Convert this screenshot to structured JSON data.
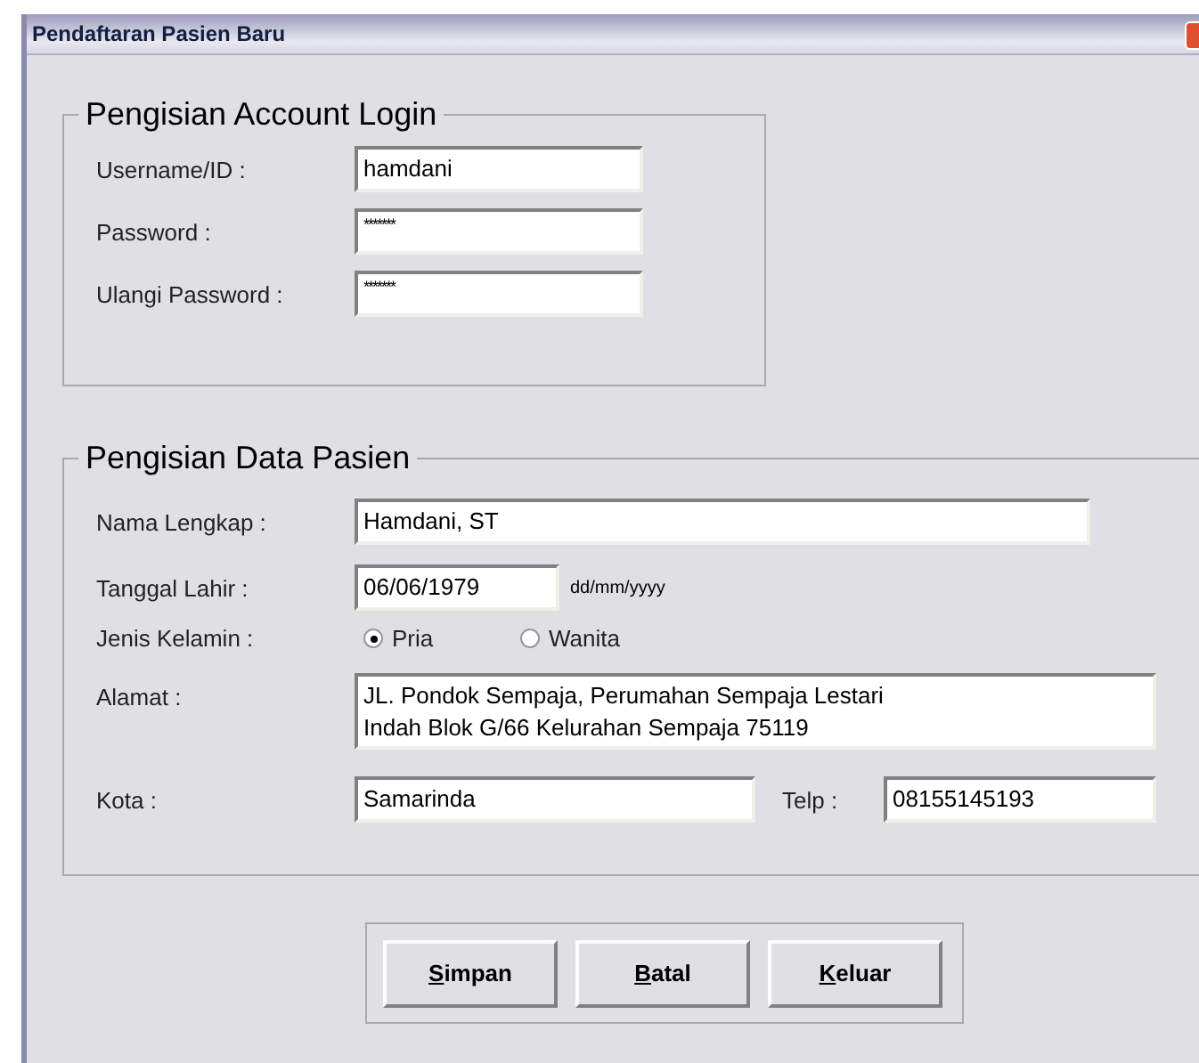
{
  "window": {
    "title": "Pendaftaran Pasien Baru"
  },
  "account_group": {
    "legend": "Pengisian Account Login",
    "fields": [
      {
        "label": "Username/ID :",
        "value": "hamdani",
        "kind": "text"
      },
      {
        "label": "Password :",
        "value": "*******",
        "kind": "password"
      },
      {
        "label": "Ulangi Password :",
        "value": "*******",
        "kind": "password"
      }
    ]
  },
  "patient_group": {
    "legend": "Pengisian Data Pasien",
    "nama": {
      "label": "Nama Lengkap :",
      "value": "Hamdani, ST"
    },
    "tanggal": {
      "label": "Tanggal Lahir :",
      "value": "06/06/1979",
      "hint": "dd/mm/yyyy"
    },
    "gender": {
      "label": "Jenis Kelamin :",
      "options": [
        {
          "label": "Pria",
          "selected": true
        },
        {
          "label": "Wanita",
          "selected": false
        }
      ]
    },
    "alamat": {
      "label": "Alamat :",
      "lines": [
        "JL. Pondok Sempaja, Perumahan Sempaja Lestari",
        "Indah Blok G/66 Kelurahan Sempaja 75119"
      ]
    },
    "kota": {
      "label": "Kota :",
      "value": "Samarinda"
    },
    "telp": {
      "label": "Telp :",
      "value": "08155145193"
    }
  },
  "buttons": [
    {
      "label": "Simpan"
    },
    {
      "label": "Batal"
    },
    {
      "label": "Keluar"
    }
  ]
}
